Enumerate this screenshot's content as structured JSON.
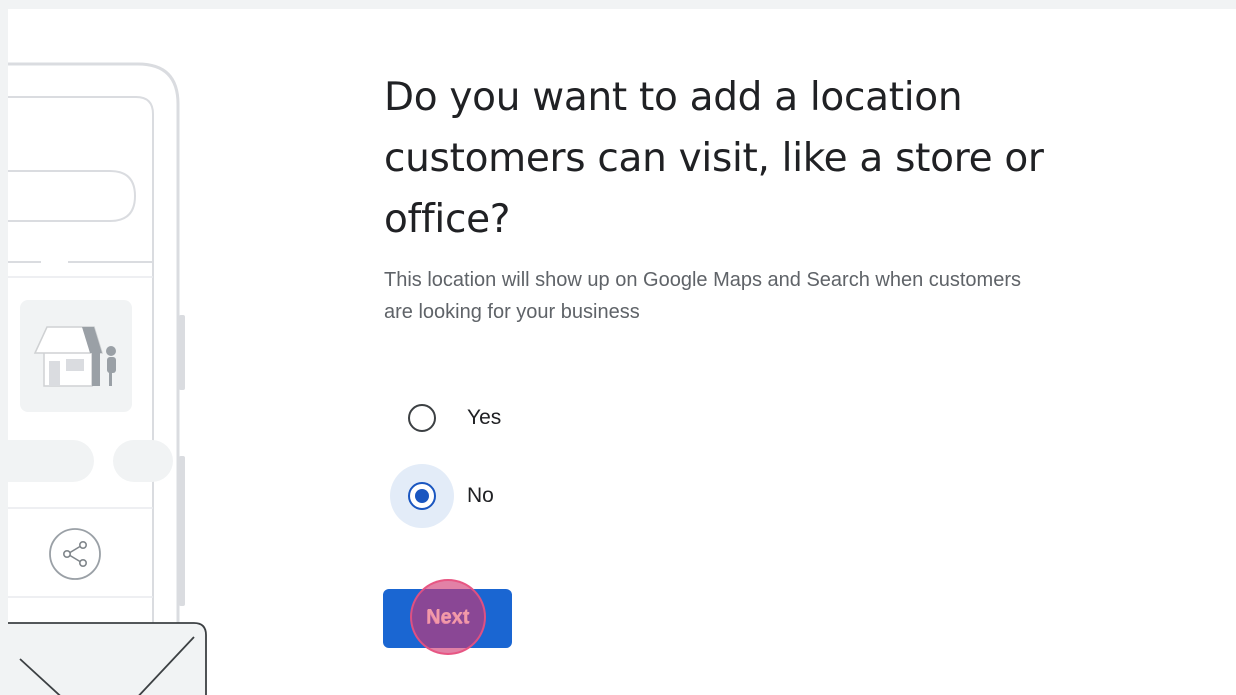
{
  "question": {
    "title": "Do you want to add a location customers can visit, like a store or office?",
    "description": "This location will show up on Google Maps and Search when customers are looking for your business"
  },
  "options": [
    {
      "label": "Yes",
      "selected": false
    },
    {
      "label": "No",
      "selected": true
    }
  ],
  "actions": {
    "next_label": "Next"
  },
  "icons": {
    "illustration": "phone-listing-illustration",
    "storefront": "storefront-icon",
    "share": "share-icon",
    "envelope": "envelope-icon"
  },
  "colors": {
    "primary": "#1a66d2",
    "radio_checked": "#1a56c0",
    "heading": "#202124",
    "body_text": "#5f6368",
    "click_marker": "#d03470"
  }
}
